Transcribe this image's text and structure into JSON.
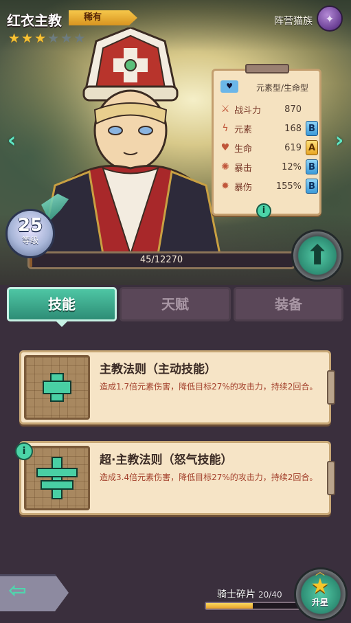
{
  "hero": {
    "name": "红衣主教",
    "rarity": "稀有",
    "stars_filled": 3,
    "stars_total": 6,
    "faction_label": "阵营猫族",
    "faction_icon": "fish-bone-icon"
  },
  "stats_panel": {
    "type_label": "元素型/生命型",
    "type_icon": "heart-tag-icon",
    "rows": [
      {
        "icon": "sword-icon",
        "name": "战斗力",
        "value": "870",
        "grade": ""
      },
      {
        "icon": "lightning-icon",
        "name": "元素",
        "value": "168",
        "grade": "B"
      },
      {
        "icon": "heart-icon",
        "name": "生命",
        "value": "619",
        "grade": "A"
      },
      {
        "icon": "burst-icon",
        "name": "暴击",
        "value": "12%",
        "grade": "B"
      },
      {
        "icon": "claw-icon",
        "name": "暴伤",
        "value": "155%",
        "grade": "B"
      }
    ]
  },
  "level": {
    "value": "25",
    "label": "等级",
    "exp_text": "45/12270",
    "exp_fraction": 0.0037
  },
  "tabs": [
    {
      "label": "技能",
      "active": true
    },
    {
      "label": "天赋",
      "active": false
    },
    {
      "label": "装备",
      "active": false
    }
  ],
  "skills": [
    {
      "name": "主教法则（主动技能）",
      "description": "造成1.7倍元素伤害，降低目标27%的攻击力，持续2回合。"
    },
    {
      "name": "超·主教法则（怒气技能）",
      "description": "造成3.4倍元素伤害，降低目标27%的攻击力，持续2回合。"
    }
  ],
  "shards": {
    "label": "骑士碎片",
    "count": "20/40",
    "fraction": 0.5
  },
  "star_up_label": "升星",
  "colors": {
    "accent_teal": "#4ec6a4",
    "card_bg": "#f6e4c6",
    "panel_bg": "#3a2f3d"
  }
}
